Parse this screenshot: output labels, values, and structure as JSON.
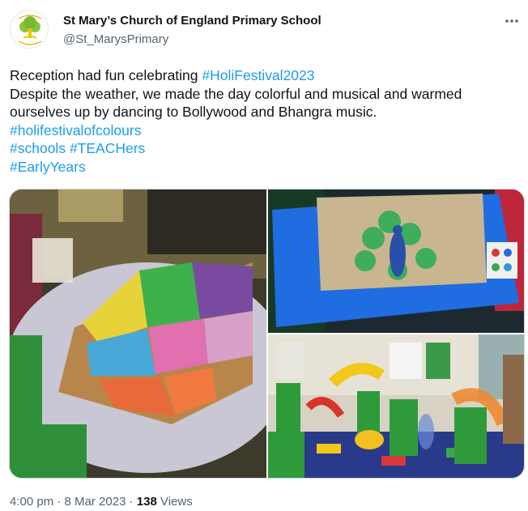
{
  "author": {
    "name": "St Mary’s Church of England Primary School",
    "handle": "@St_MarysPrimary",
    "avatar_text_top": "St Mary's",
    "avatar_text_bottom": "CE Primary School"
  },
  "tweet": {
    "line1_text": "Reception had fun celebrating ",
    "line1_tag": "#HoliFestival2023",
    "line2": "Despite the weather, we made the day colorful and musical and warmed",
    "line3": "ourselves up by dancing to Bollywood and Bhangra music.",
    "tag_colours": "#holifestivalofcolours",
    "tag_schools": "#schools",
    "tag_teachers": "#TEACHers",
    "tag_earlyyears": "#EarlyYears"
  },
  "meta": {
    "time": "4:00 pm",
    "sep1": " · ",
    "date": "8 Mar 2023",
    "sep2": " · ",
    "views_count": "138",
    "views_label": " Views"
  },
  "colors": {
    "link": "#1d9bf0",
    "text": "#0f1419",
    "secondary": "#536471"
  },
  "icons": {
    "more": "more-horizontal-icon",
    "avatar": "school-tree-logo-icon"
  }
}
